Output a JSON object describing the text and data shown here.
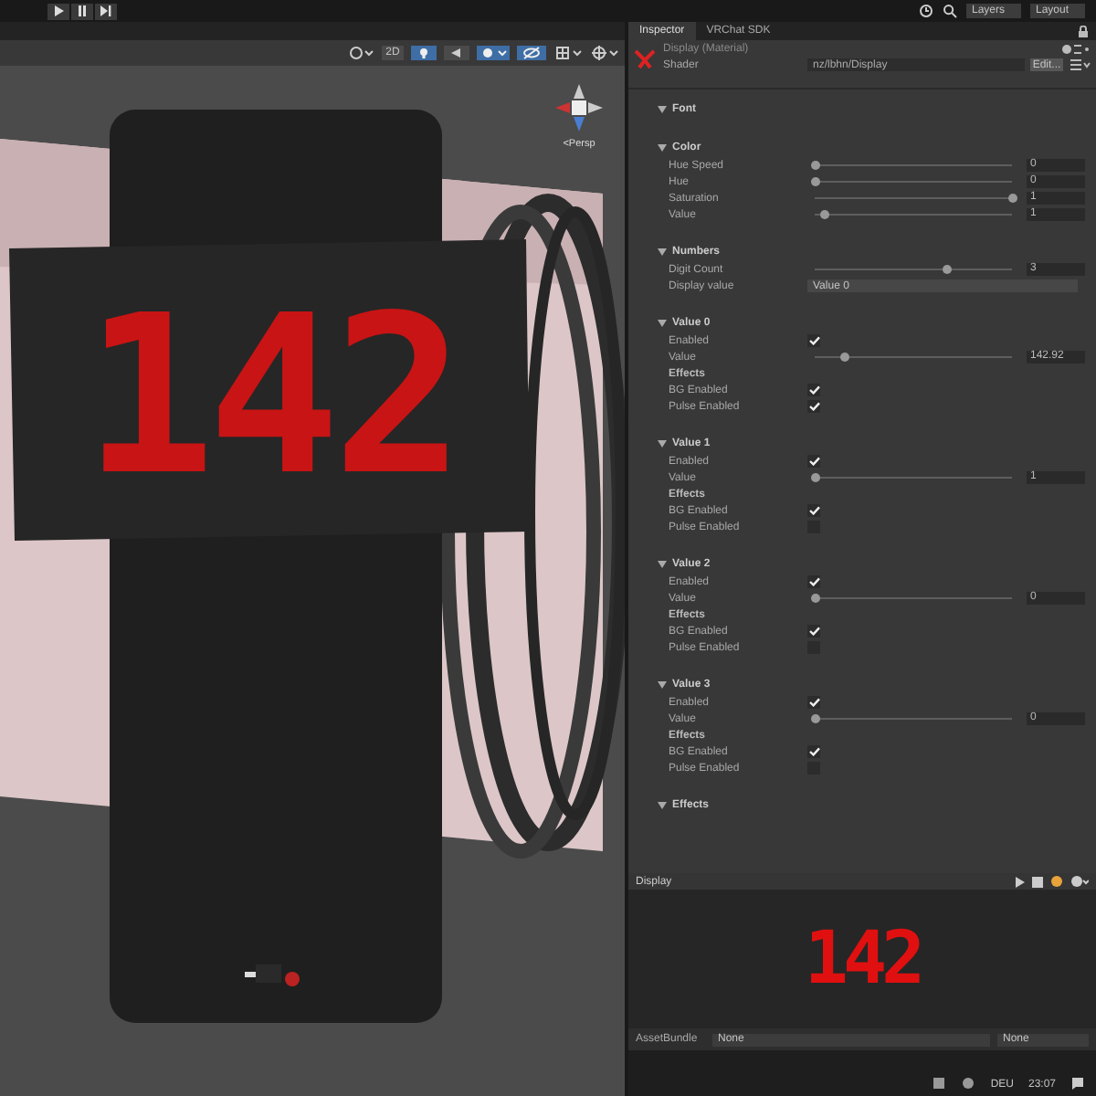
{
  "toolbar": {
    "layers": "Layers",
    "layout": "Layout"
  },
  "scene": {
    "mode_2d": "2D",
    "gizmo_label": "<Persp",
    "display_text": "142"
  },
  "inspector": {
    "tabs": [
      {
        "label": "Inspector",
        "selected": true
      },
      {
        "label": "VRChat SDK",
        "selected": false
      }
    ],
    "material": {
      "title": "Display (Material)",
      "shader_label": "Shader",
      "shader": "nz/lbhn/Display",
      "edit_button": "Edit..."
    },
    "sections": [
      {
        "title": "Font"
      },
      {
        "title": "Color",
        "rows": [
          {
            "kind": "slider",
            "label": "Hue Speed",
            "level": 0,
            "value": "0"
          },
          {
            "kind": "slider",
            "label": "Hue",
            "level": 0,
            "value": "0"
          },
          {
            "kind": "slider",
            "label": "Saturation",
            "level": 1,
            "value": "1"
          },
          {
            "kind": "slider",
            "label": "Value",
            "level": 0.05,
            "value": "1"
          }
        ]
      },
      {
        "title": "Numbers",
        "rows": [
          {
            "kind": "slider",
            "label": "Digit Count",
            "level": 0.67,
            "value": "3"
          },
          {
            "kind": "dropdown",
            "label": "Display value",
            "value": "Value 0"
          }
        ]
      },
      {
        "title": "Value 0",
        "rows": [
          {
            "kind": "checkbox",
            "label": "Enabled",
            "checked": true
          },
          {
            "kind": "slider",
            "label": "Value",
            "level": 0.15,
            "value": "142.92"
          },
          {
            "kind": "heading",
            "label": "Effects"
          },
          {
            "kind": "checkbox",
            "label": "BG Enabled",
            "checked": true
          },
          {
            "kind": "checkbox",
            "label": "Pulse Enabled",
            "checked": true
          }
        ]
      },
      {
        "title": "Value 1",
        "rows": [
          {
            "kind": "checkbox",
            "label": "Enabled",
            "checked": true
          },
          {
            "kind": "slider",
            "label": "Value",
            "level": 0,
            "value": "1"
          },
          {
            "kind": "heading",
            "label": "Effects"
          },
          {
            "kind": "checkbox",
            "label": "BG Enabled",
            "checked": true
          },
          {
            "kind": "checkbox",
            "label": "Pulse Enabled",
            "checked": false
          }
        ]
      },
      {
        "title": "Value 2",
        "rows": [
          {
            "kind": "checkbox",
            "label": "Enabled",
            "checked": true
          },
          {
            "kind": "slider",
            "label": "Value",
            "level": 0,
            "value": "0"
          },
          {
            "kind": "heading",
            "label": "Effects"
          },
          {
            "kind": "checkbox",
            "label": "BG Enabled",
            "checked": true
          },
          {
            "kind": "checkbox",
            "label": "Pulse Enabled",
            "checked": false
          }
        ]
      },
      {
        "title": "Value 3",
        "rows": [
          {
            "kind": "checkbox",
            "label": "Enabled",
            "checked": true
          },
          {
            "kind": "slider",
            "label": "Value",
            "level": 0,
            "value": "0"
          },
          {
            "kind": "heading",
            "label": "Effects"
          },
          {
            "kind": "checkbox",
            "label": "BG Enabled",
            "checked": true
          },
          {
            "kind": "checkbox",
            "label": "Pulse Enabled",
            "checked": false
          }
        ]
      },
      {
        "title": "Effects"
      }
    ],
    "preview": {
      "title": "Display",
      "display_text": "142"
    },
    "asset_bundle": {
      "label": "AssetBundle",
      "bundle": "None",
      "variant": "None"
    }
  },
  "taskbar": {
    "language": "DEU",
    "time": "23:07"
  }
}
